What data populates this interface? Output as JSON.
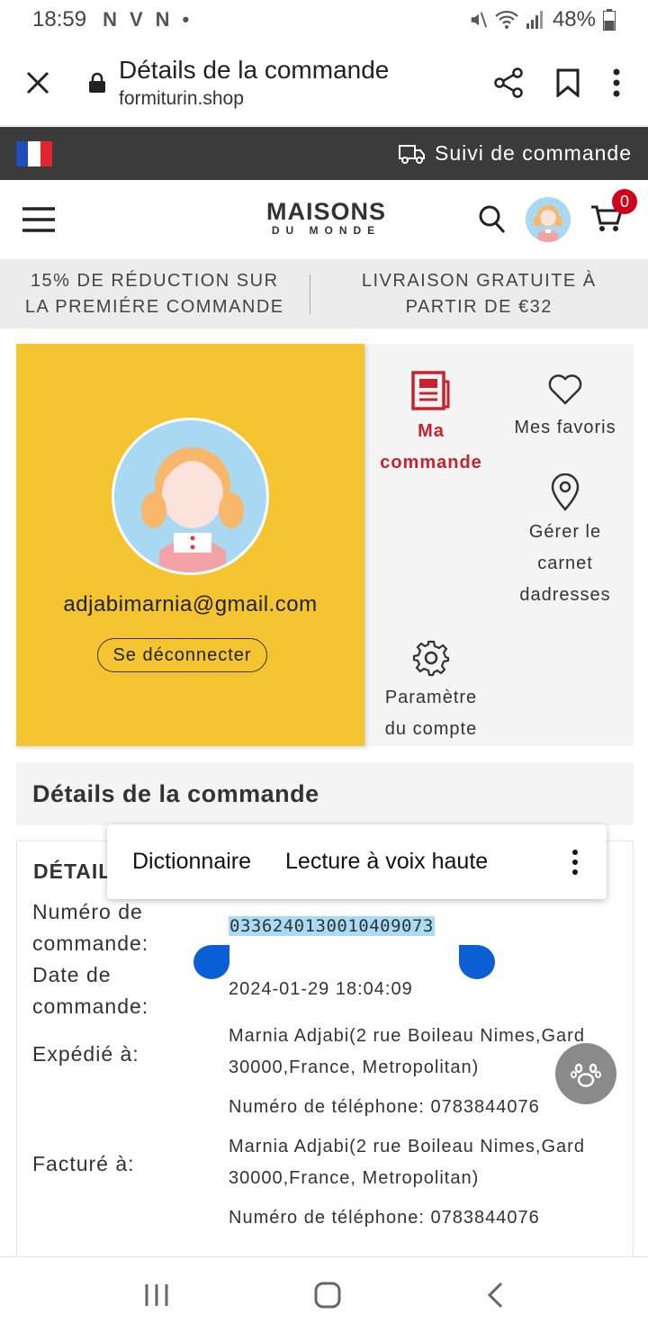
{
  "status_bar": {
    "time": "18:59",
    "notif_icons": [
      "N",
      "V",
      "N",
      "•"
    ],
    "battery": "48%"
  },
  "browser": {
    "title": "Détails de la commande",
    "url": "formiturin.shop"
  },
  "top_bar": {
    "tracking_label": "Suivi de commande"
  },
  "header": {
    "logo_line1": "MAISONS",
    "logo_line2": "DU MONDE",
    "cart_count": "0"
  },
  "promo": {
    "left": "15% DE RÉDUCTION SUR LA PREMIÉRE COMMANDE",
    "right": "LIVRAISON GRATUITE À PARTIR DE €32"
  },
  "account": {
    "email": "adjabimarnia@gmail.com",
    "logout_label": "Se déconnecter",
    "menu": {
      "orders": "Ma commande",
      "favorites": "Mes favoris",
      "addresses": "Gérer le carnet dadresses",
      "settings": "Paramètre du compte"
    }
  },
  "details": {
    "section_title": "Détails de la commande",
    "sub_title": "DÉTAIL",
    "order_number_label": "Numéro de commande:",
    "order_number": "0336240130010409073",
    "order_date_label": "Date de commande:",
    "order_date": "2024-01-29 18:04:09",
    "shipped_label": "Expédié à:",
    "shipped_address": "Marnia Adjabi(2 rue Boileau Nimes,Gard 30000,France, Metropolitan)",
    "shipped_phone": "Numéro de téléphone: 0783844076",
    "billed_label": "Facturé à:",
    "billed_address": "Marnia Adjabi(2 rue Boileau Nimes,Gard 30000,France, Metropolitan)",
    "billed_phone": "Numéro de téléphone: 0783844076"
  },
  "popup": {
    "dictionary": "Dictionnaire",
    "read_aloud": "Lecture à voix haute"
  }
}
